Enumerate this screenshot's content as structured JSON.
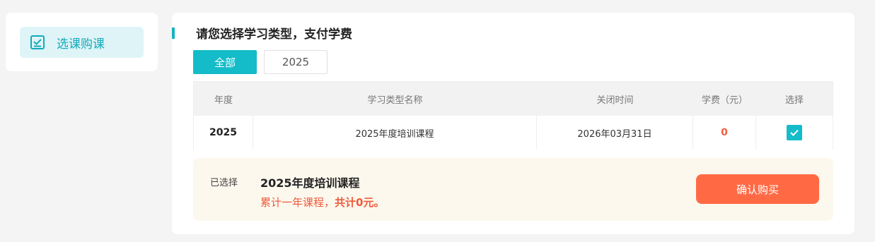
{
  "sidebar": {
    "items": [
      {
        "label": "选课购课",
        "icon": "checklist-icon",
        "active": true
      }
    ]
  },
  "main": {
    "title": "请您选择学习类型，支付学费",
    "filters": [
      {
        "label": "全部",
        "active": true
      },
      {
        "label": "2025",
        "active": false
      }
    ],
    "table": {
      "headers": [
        "年度",
        "学习类型名称",
        "关闭时间",
        "学费（元）",
        "选择"
      ],
      "rows": [
        {
          "year": "2025",
          "name": "2025年度培训课程",
          "close_time": "2026年03月31日",
          "fee": "0",
          "selected": true
        }
      ]
    },
    "summary": {
      "selected_label": "已选择",
      "course_name": "2025年度培训课程",
      "desc_prefix": "累计一年课程，",
      "total_text": "共计0元。",
      "buy_label": "确认购买"
    }
  },
  "colors": {
    "accent": "#14bcc9",
    "buy_button": "#ff6a45",
    "summary_bg": "#fdf8ee",
    "fee": "#f06040"
  }
}
